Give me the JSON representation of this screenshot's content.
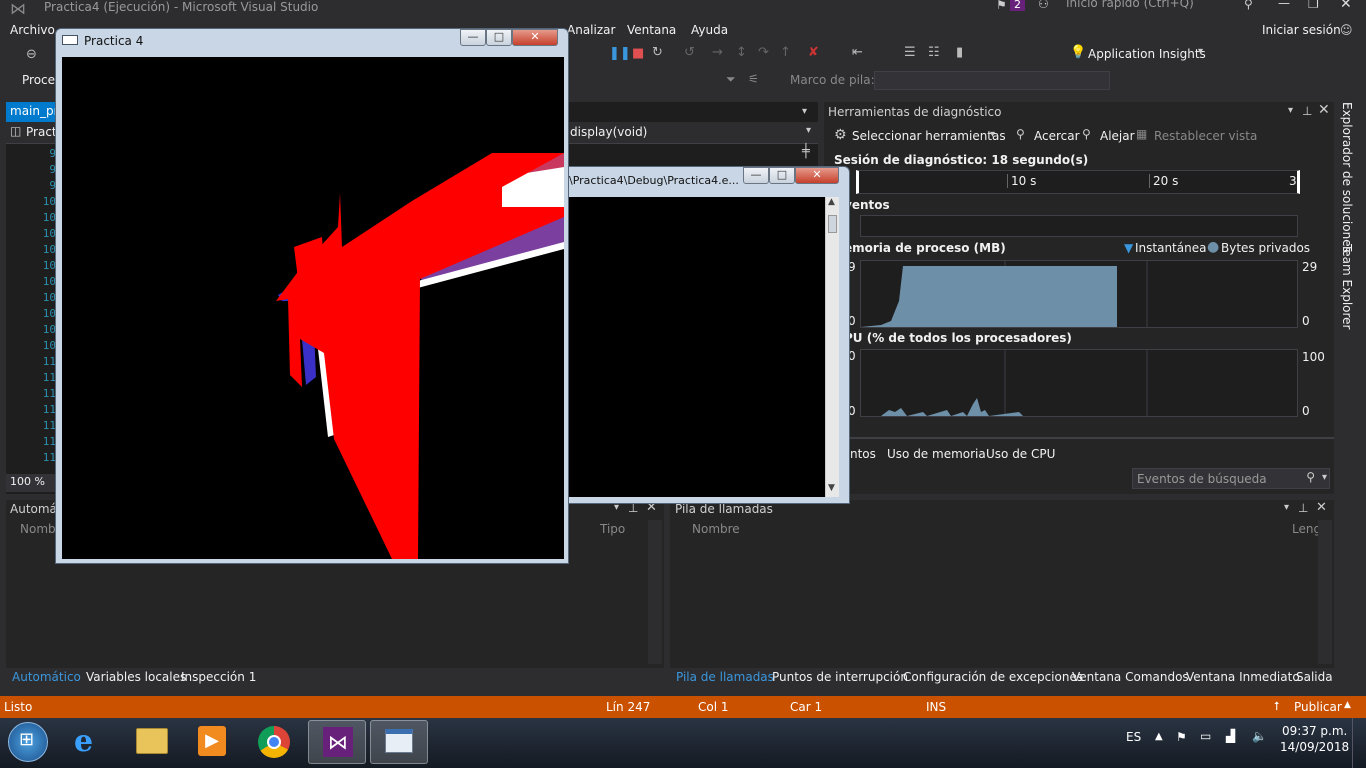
{
  "window": {
    "title": "Practica4 (Ejecución) - Microsoft Visual Studio",
    "notif_count": "2",
    "quick_launch": "Inicio rápido (Ctrl+Q)",
    "signin": "Iniciar sesión"
  },
  "menu": [
    "Archivo",
    "Analizar",
    "Ventana",
    "Ayuda"
  ],
  "toolbar": {
    "app_insights": "Application Insights",
    "proc_label": "Proce",
    "stack_label": "Marco de pila:"
  },
  "editor": {
    "tab": "main_pr",
    "file_label": "Practi",
    "func": "display(void)",
    "zoom": "100 %",
    "line_numbers": [
      "9",
      "9",
      "9",
      "10",
      "10",
      "10",
      "10",
      "10",
      "10",
      "10",
      "10",
      "10",
      "10",
      "11",
      "11",
      "11",
      "11",
      "11",
      "11",
      "11"
    ]
  },
  "console": {
    "path": "\\Practica4\\Debug\\Practica4.e..."
  },
  "glut": {
    "title": "Practica 4"
  },
  "diag": {
    "title": "Herramientas de diagnóstico",
    "select_tools": "Seleccionar herramientas",
    "zoom_in": "Acercar",
    "zoom_out": "Alejar",
    "reset_view": "Restablecer vista",
    "session": "Sesión de diagnóstico: 18 segundo(s)",
    "ticks": [
      "10 s",
      "20 s",
      "3"
    ],
    "events": "ventos",
    "memory_title": "emoria de proceso (MB)",
    "legend_snapshot": "Instantánea",
    "legend_private": "Bytes privados",
    "mem_max": "29",
    "mem_min": "0",
    "cpu_title": "PU (% de todos los procesadores)",
    "cpu_max": "100",
    "cpu_min": "0",
    "left_val_a": "9",
    "left_val_b": "0",
    "left_val_c": "0",
    "left_val_d": "0",
    "tabs": [
      "ntos",
      "Uso de memoria",
      "Uso de CPU"
    ],
    "search": "Eventos de búsqueda",
    "side_tabs": [
      "Explorador de soluciones",
      "Team Explorer"
    ]
  },
  "autos": {
    "title": "Automá",
    "col_name": "Nomb",
    "col_type": "Tipo",
    "tabs": [
      "Automático",
      "Variables locales",
      "Inspección 1"
    ]
  },
  "callstack": {
    "title": "Pila de llamadas",
    "col_name": "Nombre",
    "col_lang": "Leng",
    "tabs": [
      "Pila de llamadas",
      "Puntos de interrupción",
      "Configuración de excepciones",
      "Ventana Comandos",
      "Ventana Inmediato",
      "Salida"
    ]
  },
  "status": {
    "ready": "Listo",
    "line": "Lín 247",
    "col": "Col 1",
    "car": "Car 1",
    "ins": "INS",
    "publish": "Publicar"
  },
  "taskbar": {
    "lang": "ES",
    "time": "09:37 p.m.",
    "date": "14/09/2018"
  },
  "colors": {
    "accent": "#007acc",
    "status": "#ca5100",
    "chart_fill": "#6d8fa8"
  }
}
